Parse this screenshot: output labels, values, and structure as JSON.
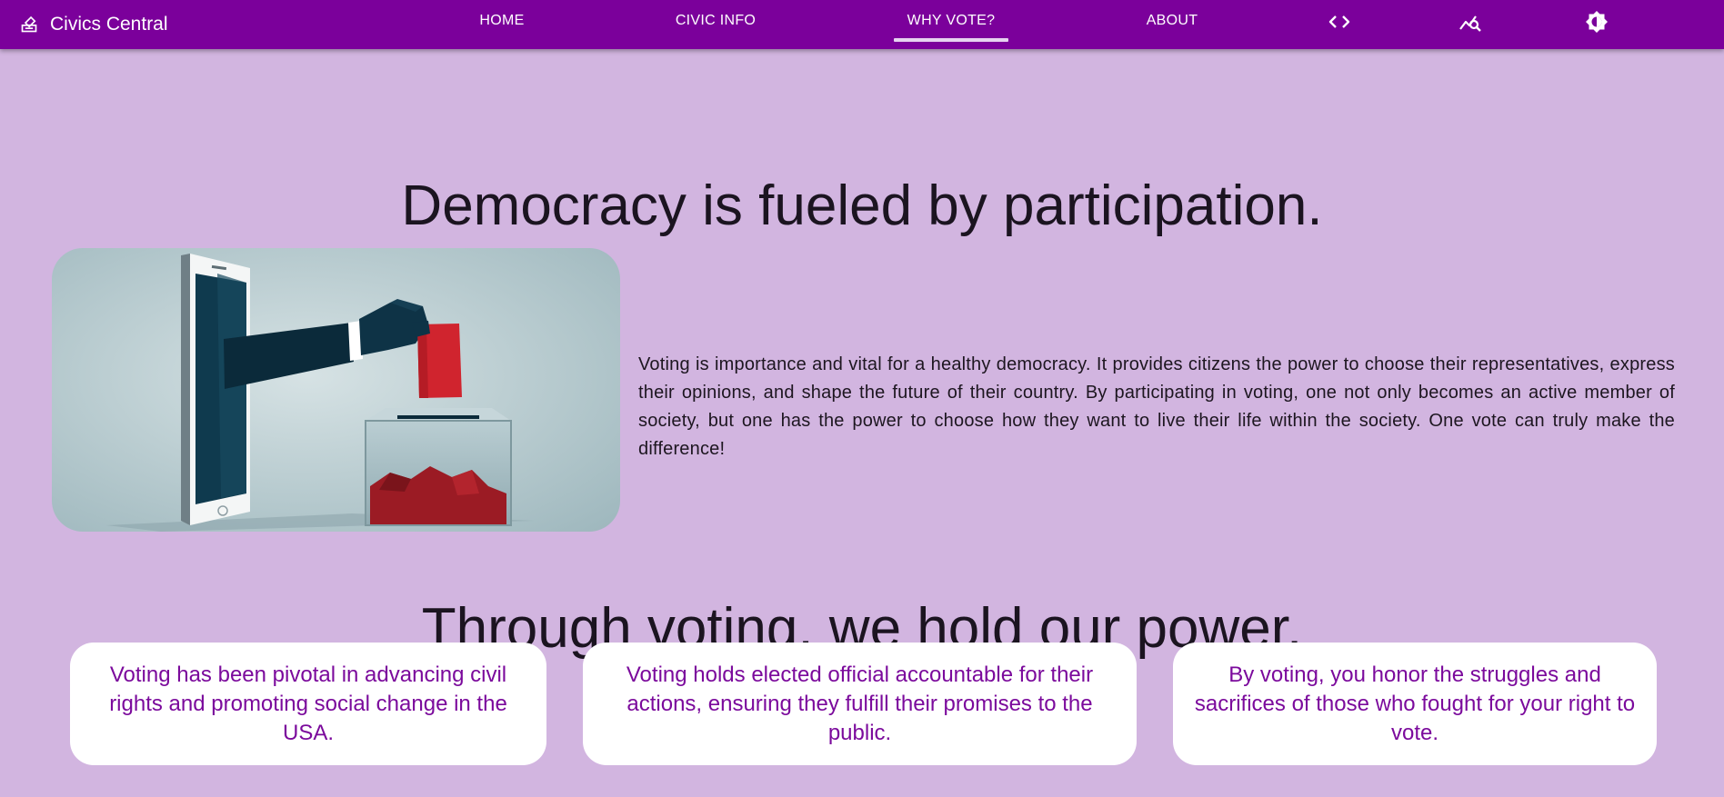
{
  "header": {
    "brand": {
      "name": "Civics Central",
      "icon": "ballot-box-icon"
    },
    "nav": [
      {
        "label": "HOME",
        "active": false
      },
      {
        "label": "CIVIC INFO",
        "active": false
      },
      {
        "label": "WHY VOTE?",
        "active": true
      },
      {
        "label": "ABOUT",
        "active": false
      }
    ],
    "icons": [
      "code-icon",
      "analytics-search-icon",
      "brightness-icon"
    ]
  },
  "main": {
    "heading": "Democracy is fueled by participation.",
    "hero_image": {
      "icon": "phone-hand-ballot-box-illustration"
    },
    "intro": "Voting is importance and vital for a healthy democracy. It provides citizens the power to choose their representatives, express their opinions, and shape the future of their country. By participating in voting, one not only becomes an active member of society, but one has the power to choose how they want to live their life within the society. One vote can truly make the difference!",
    "subheading": "Through voting, we hold our power.",
    "cards": [
      {
        "text": "Voting has been pivotal in advancing civil rights and promoting social change in the USA."
      },
      {
        "text": "Voting holds elected official accountable for their actions, ensuring they fulfill their promises to the public."
      },
      {
        "text": "By voting, you honor the struggles and sacrifices of those who fought for your right to vote."
      }
    ]
  },
  "colors": {
    "header_bg": "#7b009b",
    "page_bg": "#d2b5e0",
    "card_text": "#7b0a9c",
    "card_bg": "#ffffff",
    "ballot_red": "#d0242e"
  }
}
